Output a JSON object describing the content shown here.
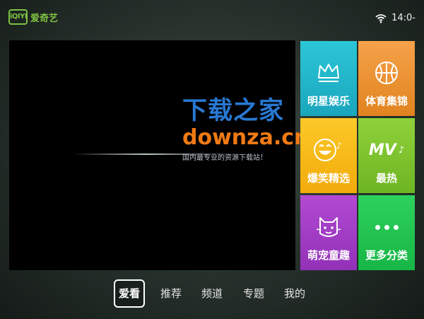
{
  "app": {
    "logo_mark": "iQIYI",
    "name": "爱奇艺"
  },
  "status": {
    "wifi_icon": "wifi-icon",
    "time": "14:0-"
  },
  "watermark": {
    "title": "下载之家",
    "domain": "downza.cn",
    "tagline": "国内最专业的资源下载站！"
  },
  "tiles": [
    {
      "label": "明星娱乐",
      "icon": "crown-icon",
      "color": "#1fb3c9"
    },
    {
      "label": "体育集锦",
      "icon": "basketball-icon",
      "color": "#ea9132"
    },
    {
      "label": "爆笑精选",
      "icon": "laughing-face-icon",
      "color": "#f7ba15"
    },
    {
      "label": "最热",
      "icon": "mv-music-icon",
      "icon_text": "MV",
      "color": "#7ec32c"
    },
    {
      "label": "萌宠童趣",
      "icon": "pet-cat-icon",
      "color": "#a23dc6"
    },
    {
      "label": "更多分类",
      "icon": "more-dots-icon",
      "color": "#22c450"
    }
  ],
  "nav": {
    "items": [
      "爱看",
      "推荐",
      "频道",
      "专题",
      "我的"
    ],
    "active": "爱看"
  }
}
